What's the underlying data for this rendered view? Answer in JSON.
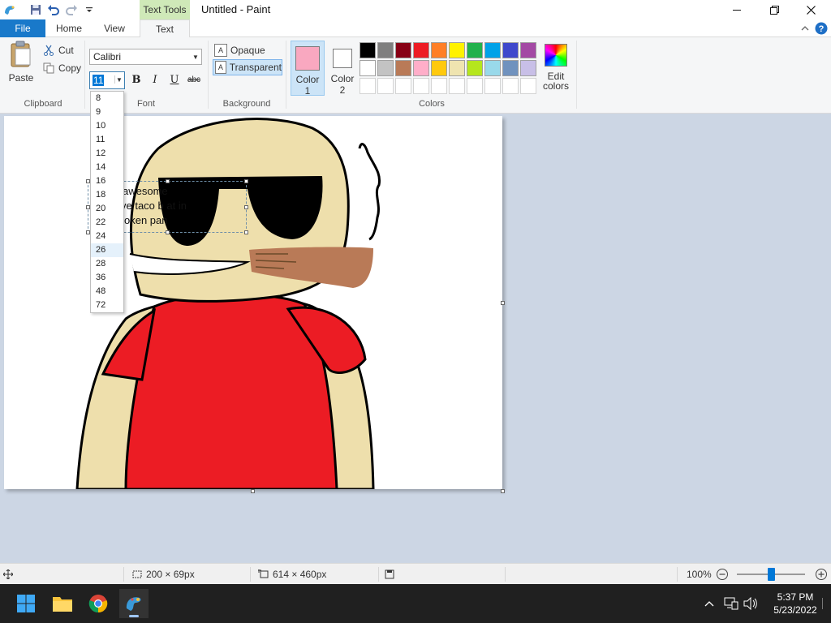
{
  "titlebar": {
    "context_tab_label": "Text Tools",
    "window_title": "Untitled - Paint"
  },
  "tabs": [
    {
      "label": "File"
    },
    {
      "label": "Home"
    },
    {
      "label": "View"
    },
    {
      "label": "Text"
    }
  ],
  "ribbon": {
    "clipboard": {
      "paste": "Paste",
      "cut": "Cut",
      "copy": "Copy",
      "group": "Clipboard"
    },
    "font": {
      "family": "Calibri",
      "size": "11",
      "bold": "B",
      "italic": "I",
      "underline": "U",
      "strikethrough": "abc",
      "group": "Font"
    },
    "background": {
      "opaque": "Opaque",
      "transparent": "Transparent",
      "group": "Background"
    },
    "colors": {
      "color1_line1": "Color",
      "color1_line2": "1",
      "color2_line1": "Color",
      "color2_line2": "2",
      "color1": "#f9a8c0",
      "color2": "#ffffff",
      "edit_line1": "Edit",
      "edit_line2": "colors",
      "group": "Colors",
      "palette_row1": [
        "#000000",
        "#7f7f7f",
        "#880015",
        "#ed1c24",
        "#ff7f27",
        "#fff200",
        "#22b14c",
        "#00a2e8",
        "#3f48cc",
        "#a349a4"
      ],
      "palette_row2": [
        "#ffffff",
        "#c3c3c3",
        "#b97a57",
        "#ffaec9",
        "#ffc90e",
        "#efe4b0",
        "#b5e61d",
        "#99d9ea",
        "#7092be",
        "#c8bfe7"
      ]
    }
  },
  "font_size_options": [
    "8",
    "9",
    "10",
    "11",
    "12",
    "14",
    "16",
    "18",
    "20",
    "22",
    "24",
    "26",
    "28",
    "36",
    "48",
    "72"
  ],
  "font_size_hover": "26",
  "canvas_text": {
    "line1": "awesome",
    "line2": "ve taco b        at in",
    "line3": "oken pan"
  },
  "statusbar": {
    "selection_size": "200 × 69px",
    "image_size": "614 × 460px",
    "zoom": "100%"
  },
  "taskbar": {
    "time": "5:37 PM",
    "date": "5/23/2022"
  }
}
